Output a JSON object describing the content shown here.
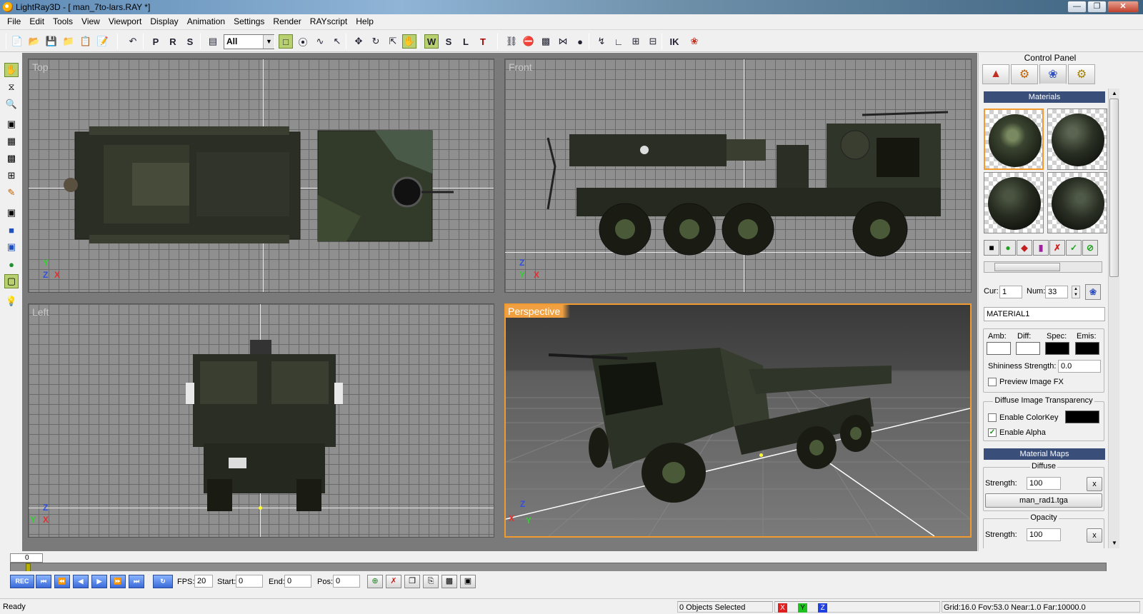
{
  "window": {
    "title": "LightRay3D - [ man_7to-lars.RAY *]"
  },
  "menu": [
    "File",
    "Edit",
    "Tools",
    "View",
    "Viewport",
    "Display",
    "Animation",
    "Settings",
    "Render",
    "RAYscript",
    "Help"
  ],
  "toolbar": {
    "filter_value": "All",
    "buttons": [
      "new-icon",
      "open-icon",
      "save-icon",
      "open-folder-icon",
      "import-icon",
      "export-icon",
      "undo-icon",
      "p-icon",
      "r-icon",
      "s-icon",
      "select-filter-icon",
      "select-region-icon",
      "lasso-icon",
      "wave-icon",
      "pointer-icon",
      "move-icon",
      "rotate-icon",
      "scale-icon",
      "hand-transform-icon",
      "w-icon",
      "s-axis-icon",
      "l-axis-icon",
      "texture-icon",
      "link-icon",
      "unlink-icon",
      "bind-icon",
      "mirror-icon",
      "group-icon",
      "bend-icon",
      "graph-icon",
      "box-plus-icon",
      "box-minus-icon",
      "ik-icon",
      "material-editor-icon"
    ]
  },
  "lefttools": [
    "hand-icon",
    "orbit-icon",
    "zoom-icon",
    "zoom-region-icon",
    "grid-icon",
    "view-icon",
    "four-views-icon",
    "paint-icon",
    "cube-icon",
    "cube-blue-icon",
    "cube-select-icon",
    "sphere-icon",
    "layer-icon",
    "light-icon"
  ],
  "viewports": {
    "top": "Top",
    "front": "Front",
    "left": "Left",
    "perspective": "Perspective"
  },
  "gizmo": {
    "top": [
      "Y",
      "Z",
      "X"
    ],
    "front": [
      "Z",
      "Y",
      "X"
    ],
    "left": [
      "Z",
      "Y",
      "X"
    ],
    "persp": [
      "Z",
      "X",
      "Y"
    ]
  },
  "control_panel": {
    "title": "Control Panel",
    "tabs": [
      "scene-objects-icon",
      "tools-icon",
      "materials-icon",
      "settings-icon"
    ],
    "materials_header": "Materials",
    "cur_label": "Cur:",
    "cur_value": "1",
    "num_label": "Num:",
    "num_value": "33",
    "material_name": "MATERIAL1",
    "amb_label": "Amb:",
    "diff_label": "Diff:",
    "spec_label": "Spec:",
    "emis_label": "Emis:",
    "colors": {
      "amb": "#ffffff",
      "diff": "#ffffff",
      "spec": "#000000",
      "emis": "#000000",
      "colorkey": "#000000",
      "section": "#3a4e7a",
      "accent": "#f09a30"
    },
    "shininess_label": "Shininess Strength:",
    "shininess_value": "0.0",
    "preview_fx": "Preview Image FX",
    "diffuse_transparency": "Diffuse Image Transparency",
    "enable_colorkey": "Enable ColorKey",
    "enable_alpha": "Enable Alpha",
    "material_maps": "Material Maps",
    "diffuse": "Diffuse",
    "strength_label": "Strength:",
    "diffuse_strength": "100",
    "diffuse_file": "man_rad1.tga",
    "opacity": "Opacity",
    "opacity_strength": "100",
    "clear_glyph": "x"
  },
  "timeline": {
    "frame": "0"
  },
  "playbar": {
    "rec": "REC",
    "fps_label": "FPS:",
    "fps": "20",
    "start_label": "Start:",
    "start": "0",
    "end_label": "End:",
    "end": "0",
    "pos_label": "Pos:",
    "pos": "0"
  },
  "status": {
    "ready": "Ready",
    "selected": "0 Objects Selected",
    "x": "X",
    "y": "Y",
    "z": "Z",
    "info": "Grid:16.0 Fov:53.0 Near:1.0 Far:10000.0"
  }
}
